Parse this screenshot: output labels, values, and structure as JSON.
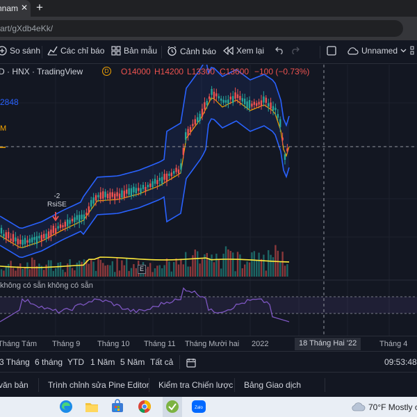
{
  "browser": {
    "tab_title": "nnam",
    "tab_close": "✕",
    "new_tab": "+",
    "url": "art/gXdb4eKk/"
  },
  "toolbar": {
    "compare": "So sánh",
    "indicators": "Các chỉ báo",
    "templates": "Bản mẫu",
    "alerts": "Cảnh báo",
    "replay": "Xem lại",
    "layout_name": "Unnamed"
  },
  "legend": {
    "symbol": "D · HNX · TradingView",
    "badge": "D",
    "open": "O14000",
    "high": "H14200",
    "low": "L13300",
    "close": "C13600",
    "change": "−100 (−0.73%)",
    "side_value": "2848",
    "side_m": "M",
    "indicator_status": "không có sẵn  không có sẵn",
    "signal_value": "-2",
    "signal_name": "RsiSE",
    "event_marker": "E"
  },
  "colors": {
    "up": "#26a69a",
    "down": "#ef5350",
    "band": "#2962ff",
    "basis": "#f7a600",
    "volume_ma": "#ffeb3b",
    "rsi": "#7e57c2",
    "background": "#131722"
  },
  "chart_data": {
    "type": "candlestick",
    "last_bar": {
      "open": 14000,
      "high": 14200,
      "low": 13300,
      "close": 13600,
      "change": -100,
      "change_pct": -0.73
    },
    "x_ticks": [
      "Tháng Tám",
      "Tháng 9",
      "Tháng 10",
      "Tháng 11",
      "Tháng Mười hai",
      "2022",
      "Tháng 4"
    ],
    "crosshair_date": "18 Tháng Hai '22",
    "indicators": [
      "Bollinger Bands",
      "Volume",
      "RSI"
    ]
  },
  "time_axis": {
    "ticks": [
      "Tháng Tám",
      "Tháng 9",
      "Tháng 10",
      "Tháng 11",
      "Tháng Mười hai",
      "2022",
      "Tháng 4"
    ],
    "crosshair": "18 Tháng Hai '22"
  },
  "ranges": {
    "items": [
      "3 Tháng",
      "6 tháng",
      "YTD",
      "1 Năm",
      "5 Năm",
      "Tất cả"
    ],
    "clock": "09:53:48"
  },
  "panel_tabs": [
    "văn bản",
    "Trình chỉnh sửa Pine Editor",
    "Kiểm tra Chiến lược",
    "Bảng Giao dịch"
  ],
  "taskbar": {
    "weather": "70°F  Mostly c",
    "zalo": "Zalo"
  }
}
